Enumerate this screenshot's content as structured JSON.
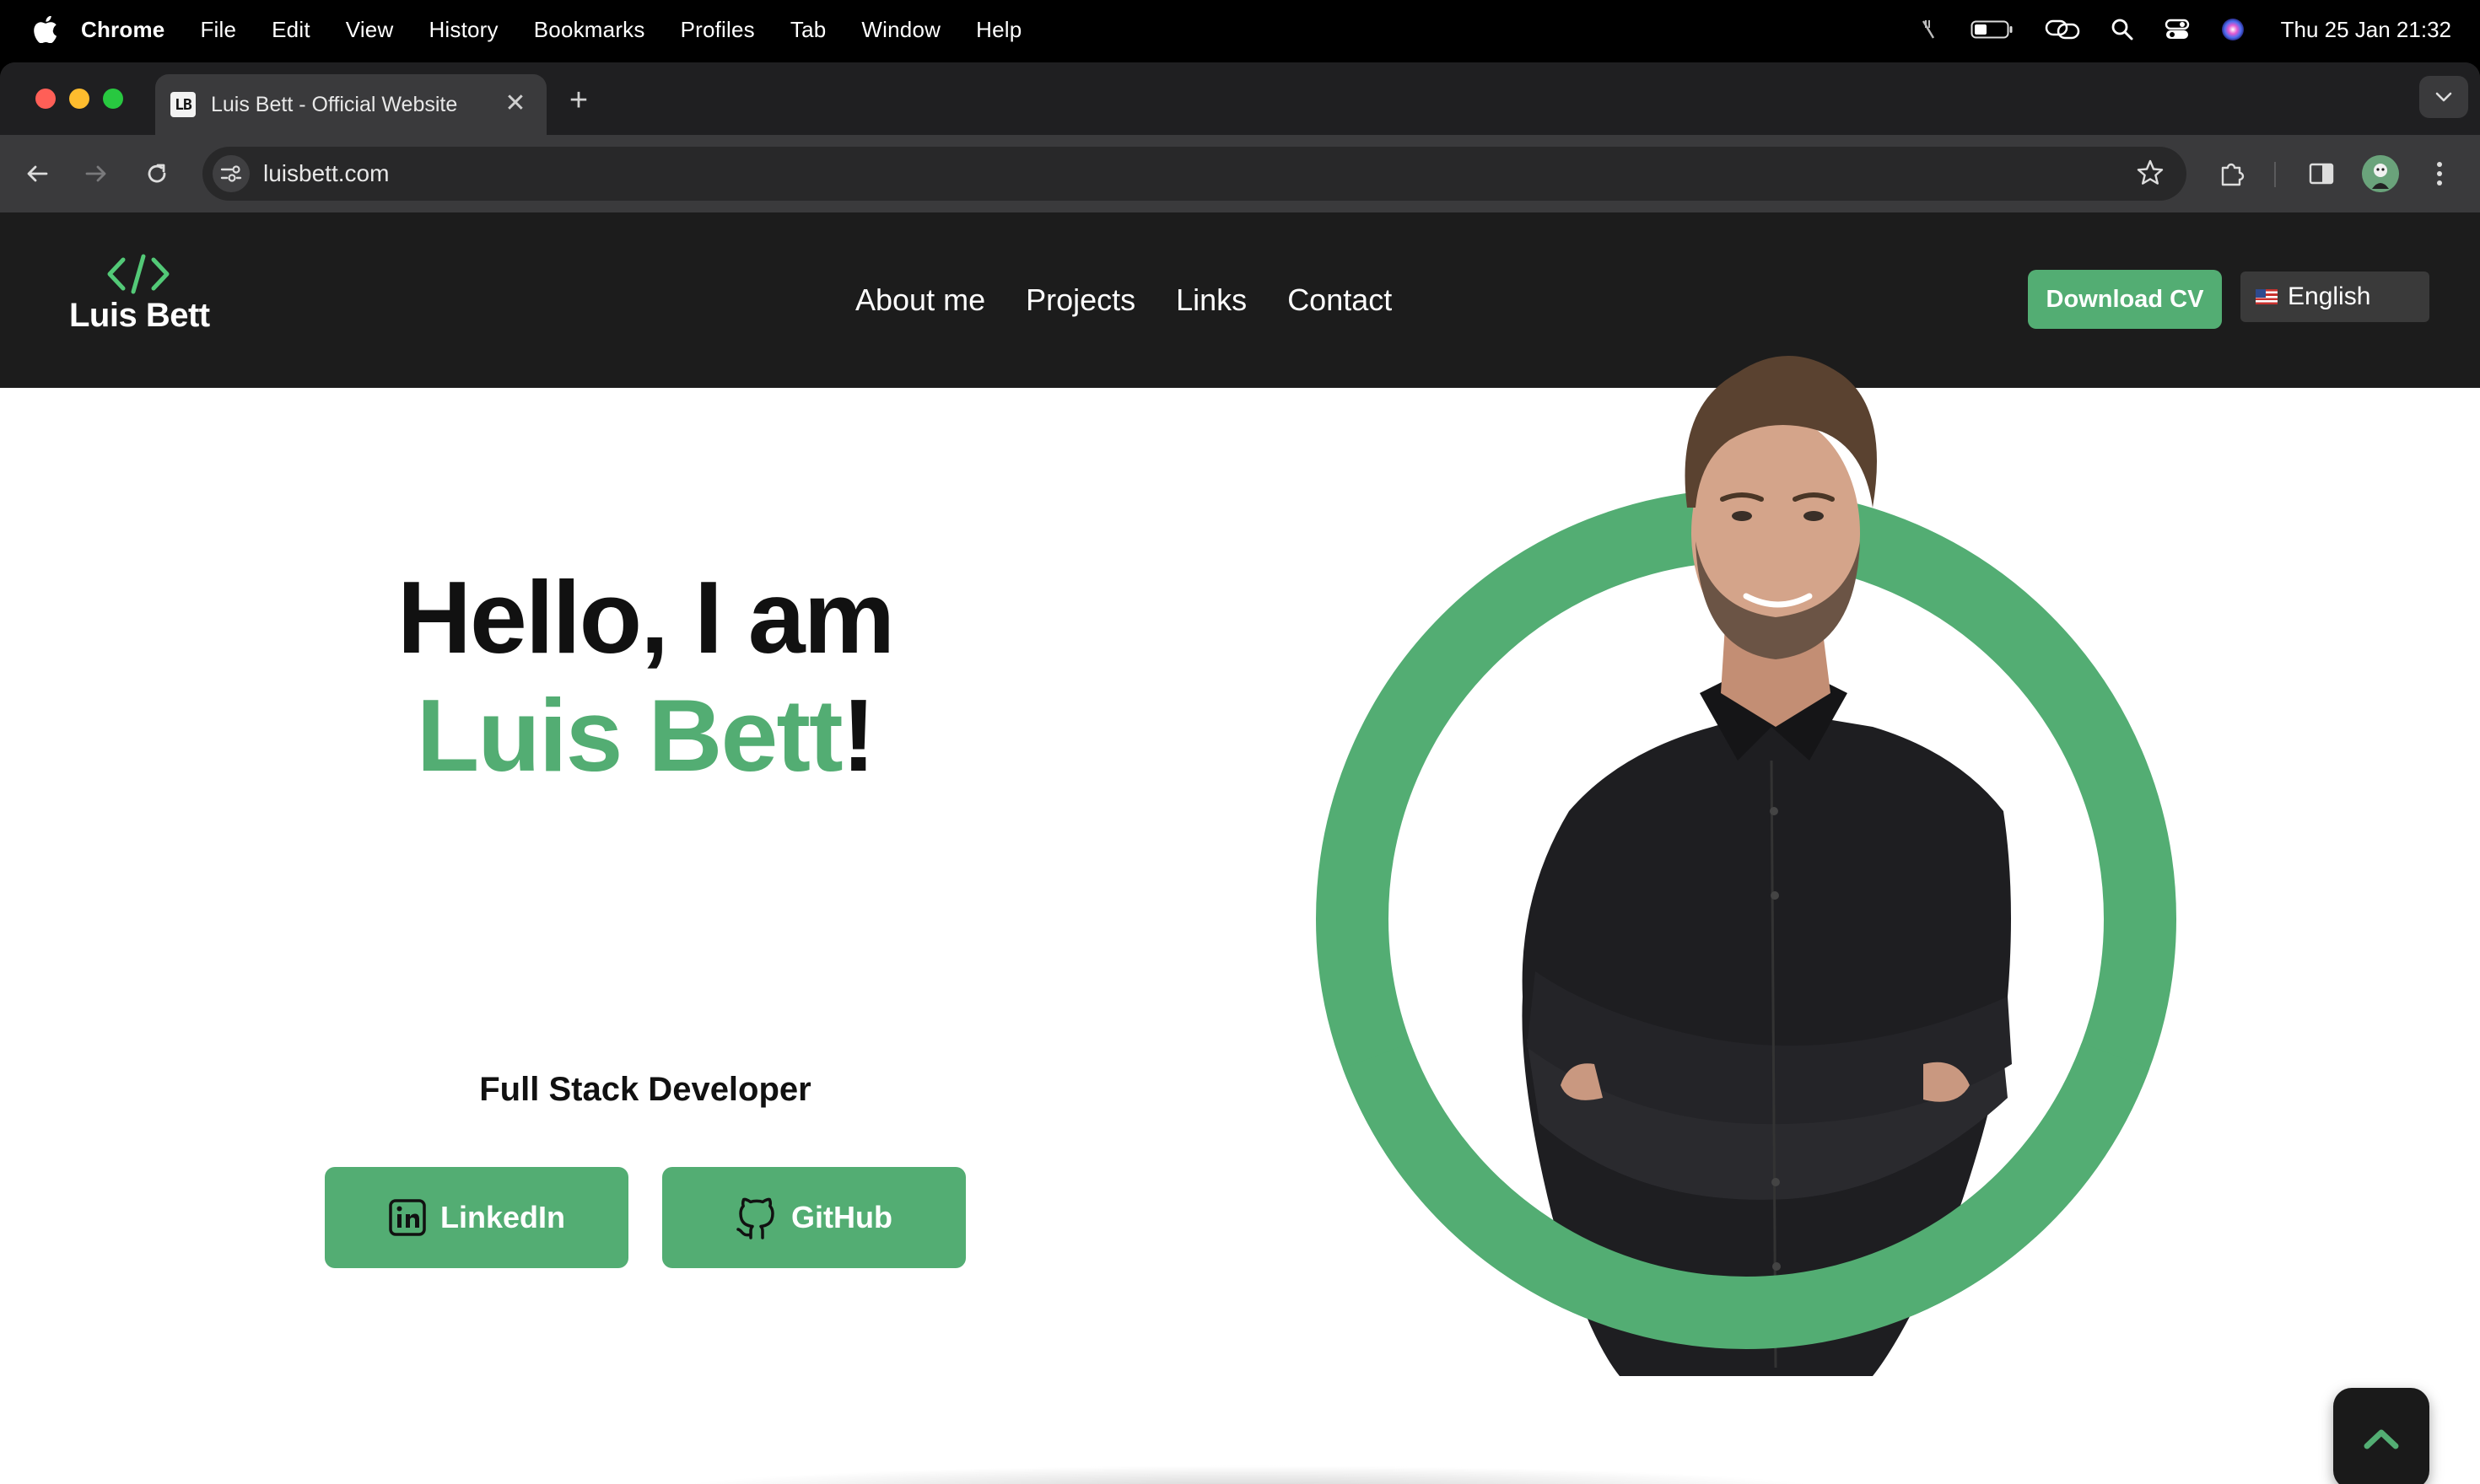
{
  "menubar": {
    "app_name": "Chrome",
    "items": [
      "File",
      "Edit",
      "View",
      "History",
      "Bookmarks",
      "Profiles",
      "Tab",
      "Window",
      "Help"
    ],
    "clock": "Thu 25 Jan  21:32",
    "icons": [
      "mute-icon",
      "battery-icon",
      "screen-mirroring-icon",
      "spotlight-search-icon",
      "control-center-icon",
      "siri-icon"
    ]
  },
  "browser": {
    "tab_title": "Luis Bett - Official Website",
    "tab_favicon_text": "LB",
    "new_tab_symbol": "+",
    "close_symbol": "✕",
    "url": "luisbett.com"
  },
  "site": {
    "logo_name": "Luis Bett",
    "nav": [
      "About me",
      "Projects",
      "Links",
      "Contact"
    ],
    "download_cv": "Download CV",
    "language": "English",
    "hero_line1": "Hello, I am",
    "hero_name": "Luis Bett",
    "hero_exclaim": "!",
    "role": "Full Stack Developer",
    "linkedin_label": "LinkedIn",
    "github_label": "GitHub"
  },
  "colors": {
    "accent": "#53ad73",
    "header_bg": "#1c1c1c",
    "page_bg": "#ffffff"
  }
}
